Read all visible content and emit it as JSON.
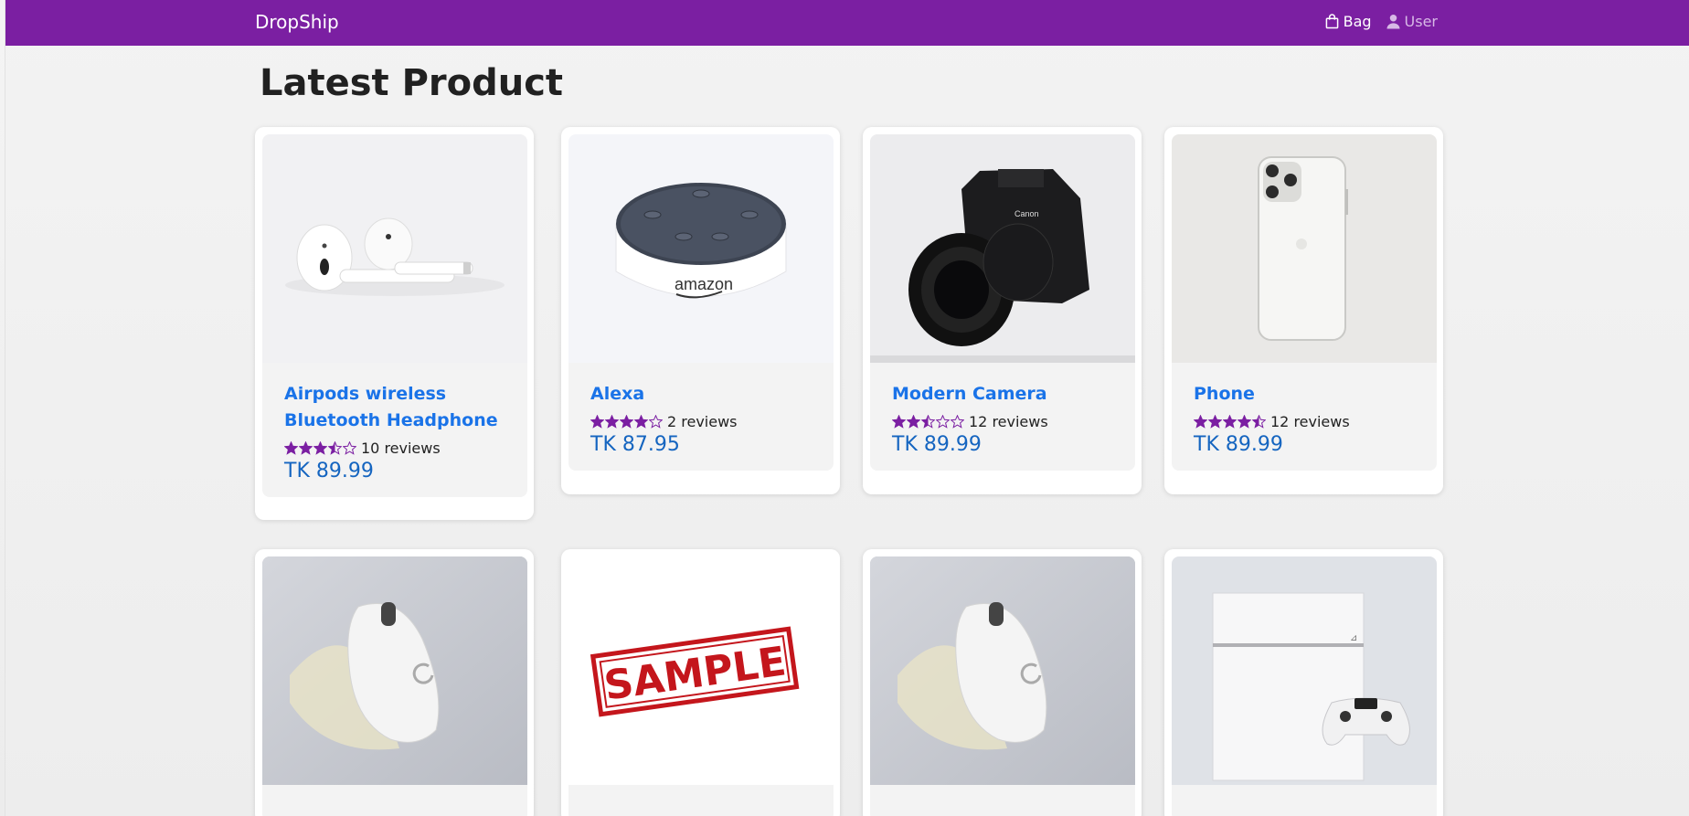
{
  "navbar": {
    "brand": "DropShip",
    "bag_label": "Bag",
    "user_label": "User",
    "background": "#7b1fa2"
  },
  "main": {
    "title": "Latest Product"
  },
  "products": [
    {
      "name": "Airpods wireless Bluetooth Headphone",
      "rating": 3.5,
      "reviews": "10 reviews",
      "price": "TK 89.99",
      "image": "airpods-image"
    },
    {
      "name": "Alexa",
      "rating": 4,
      "reviews": "2 reviews",
      "price": "TK 87.95",
      "image": "amazon-echo-dot-image"
    },
    {
      "name": "Modern Camera",
      "rating": 2.5,
      "reviews": "12 reviews",
      "price": "TK 89.99",
      "image": "canon-camera-image"
    },
    {
      "name": "Phone",
      "rating": 4.5,
      "reviews": "12 reviews",
      "price": "TK 89.99",
      "image": "iphone-image"
    },
    {
      "image": "logitech-mouse-image"
    },
    {
      "image": "sample-stamp-image",
      "image_text": "SAMPLE"
    },
    {
      "image": "logitech-mouse-image"
    },
    {
      "image": "playstation-console-image"
    }
  ],
  "colors": {
    "star": "#7b1fa2",
    "name": "#1a73e8",
    "price": "#1565c0"
  }
}
